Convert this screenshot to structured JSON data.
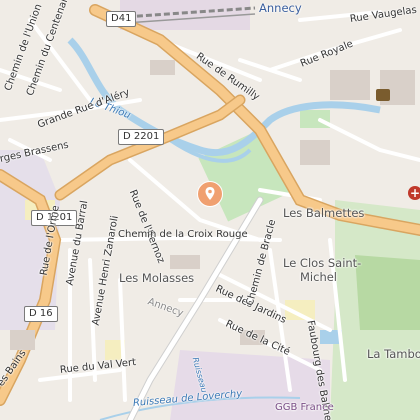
{
  "map": {
    "labels": {
      "annecy_top": "Annecy",
      "rue_vaugelas": "Rue Vaugelas",
      "rue_royale": "Rue Royale",
      "rue_rumilly": "Rue de Rumilly",
      "chemin_union": "Chemin de l'Union",
      "chemin_centenaire": "Chemin du Centenaire",
      "le_thiou": "Le Thiou",
      "grande_rue_aleri": "Grande Rue d'Aléry",
      "georges_brassens": "rges Brassens",
      "rue_iternoz": "Rue de l'Iternoz",
      "chemin_croix_rouge": "Chemin de la Croix Rouge",
      "les_balmettes": "Les Balmettes",
      "les_molasses": "Les Molasses",
      "annecy_mid": "Annecy",
      "rue_orme": "Rue de l'Orme",
      "avenue_barral": "Avenue du Barral",
      "avenue_zanaroli": "Avenue Henri Zanaroli",
      "rue_jardins": "Rue des Jardins",
      "chemin_bracle": "Chemin de Bracle",
      "le_clos": "Le Clos Saint-",
      "michel": "Michel",
      "faubourg_balmettes": "Faubourg des Balmettes",
      "rue_cite": "Rue de la Cité",
      "la_tambour": "La Tambour",
      "rue_val_vert": "Rue du Val Vert",
      "bains": "es Bains",
      "ruisseau_loverchy": "Ruisseau de Loverchy",
      "ggb_france": "GGB France",
      "ruisseau_small": "Ruisseau"
    },
    "shields": {
      "d41": "D41",
      "d2201": "D 2201",
      "d1201": "D 1201",
      "d16": "D 16"
    },
    "icons": {
      "poi_marker": "location-pin-icon",
      "hospital": "hospital-icon",
      "castle": "castle-icon"
    },
    "colors": {
      "background": "#f0ece6",
      "major_road": "#f7c98a",
      "major_road_edge": "#d9a560",
      "water": "#a9d0ea",
      "green": "#c7e6bd",
      "marker": "#f0a070"
    }
  }
}
